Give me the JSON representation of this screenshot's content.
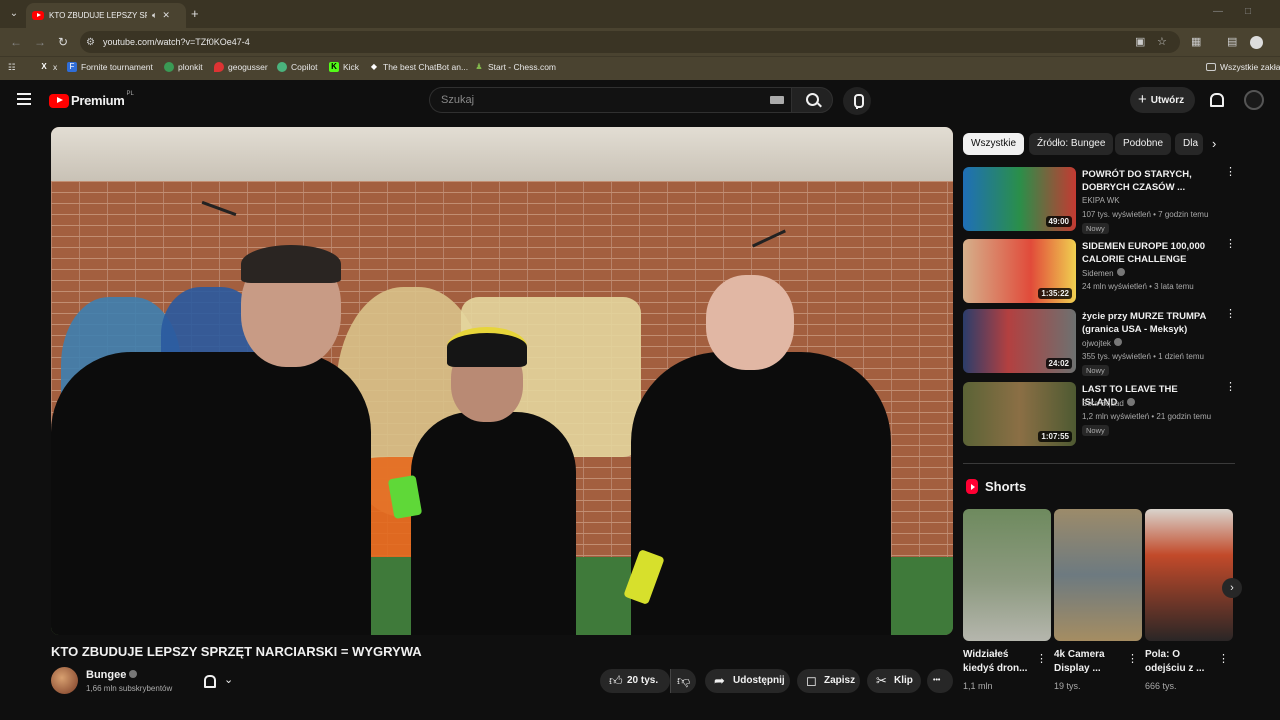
{
  "browser": {
    "tab_title": "KTO ZBUDUJE LEPSZY SPRZĘT",
    "url": "youtube.com/watch?v=TZf0KOe47-4",
    "bookmarks": [
      {
        "label": "x",
        "icon": "x-icon"
      },
      {
        "label": "Fornite tournament",
        "icon": "fortnite-icon"
      },
      {
        "label": "plonkit",
        "icon": "plonkit-icon"
      },
      {
        "label": "geogusser",
        "icon": "geoguessr-icon"
      },
      {
        "label": "Copilot",
        "icon": "copilot-icon"
      },
      {
        "label": "Kick",
        "icon": "kick-icon"
      },
      {
        "label": "The best ChatBot an...",
        "icon": "chatbot-icon"
      },
      {
        "label": "Start - Chess.com",
        "icon": "chess-icon"
      }
    ],
    "all_bookmarks_label": "Wszystkie zakład"
  },
  "header": {
    "logo_text": "Premium",
    "logo_country": "PL",
    "search_placeholder": "Szukaj",
    "create_label": "Utwórz"
  },
  "video": {
    "title": "KTO ZBUDUJE LEPSZY SPRZĘT NARCIARSKI = WYGRYWA",
    "channel": "Bungee",
    "subscribers": "1,66 mln subskrybentów",
    "likes": "20 tys.",
    "share_label": "Udostępnij",
    "save_label": "Zapisz",
    "clip_label": "Klip",
    "more_label": "•••"
  },
  "chips": [
    {
      "label": "Wszystkie",
      "active": true
    },
    {
      "label": "Źródło: Bungee",
      "active": false
    },
    {
      "label": "Podobne",
      "active": false
    },
    {
      "label": "Dla",
      "active": false
    }
  ],
  "recommendations": [
    {
      "title": "POWRÓT DO STARYCH, DOBRYCH CZASÓW ...",
      "channel": "EKIPA WK",
      "meta": "107 tys. wyświetleń • 7 godzin temu",
      "badge": "Nowy",
      "duration": "49:00",
      "verified": false
    },
    {
      "title": "SIDEMEN EUROPE 100,000 CALORIE CHALLENGE",
      "channel": "Sidemen",
      "meta": "24 mln wyświetleń • 3 lata temu",
      "badge": "",
      "duration": "1:35:22",
      "verified": true
    },
    {
      "title": "życie przy MURZE TRUMPA (granica USA - Meksyk)",
      "channel": "ojwojtek",
      "meta": "355 tys. wyświetleń • 1 dzień temu",
      "badge": "Nowy",
      "duration": "24:02",
      "verified": true
    },
    {
      "title": "LAST TO LEAVE THE ISLAND",
      "channel": "Beta Squad",
      "meta": "1,2 mln wyświetleń • 21 godzin temu",
      "badge": "Nowy",
      "duration": "1:07:55",
      "verified": true
    }
  ],
  "shorts": {
    "heading": "Shorts",
    "items": [
      {
        "title": "Widziałeś kiedyś dron...",
        "views": "1,1 mln"
      },
      {
        "title": "4k Camera Display ...",
        "views": "19 tys."
      },
      {
        "title": "Pola: O odejściu z ...",
        "views": "666 tys."
      }
    ]
  },
  "colors": {
    "brand_red": "#ff0000",
    "background": "#0f0f0f",
    "chip_bg": "#272727"
  }
}
